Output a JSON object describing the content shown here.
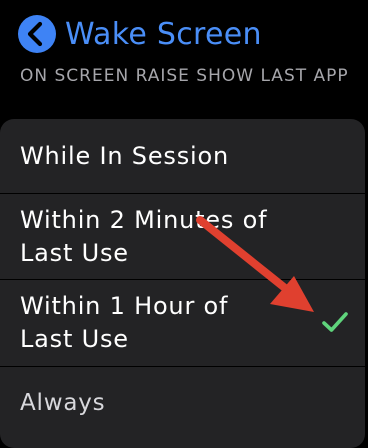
{
  "nav": {
    "back_icon": "chevron-left-icon",
    "title": "Wake Screen"
  },
  "section": {
    "header": "ON SCREEN RAISE SHOW LAST APP"
  },
  "options": [
    {
      "label": "While In Session",
      "selected": false
    },
    {
      "label": "Within 2 Minutes of Last Use",
      "selected": false
    },
    {
      "label": "Within 1 Hour of Last Use",
      "selected": true
    },
    {
      "label": "Always",
      "selected": false
    }
  ],
  "icons": {
    "checkmark": "checkmark-icon",
    "annotation": "red-arrow-icon"
  },
  "colors": {
    "background": "#000000",
    "accent": "#4a8ef7",
    "back_button": "#3e83f5",
    "cell": "#232325",
    "header_text": "#a6a6ab",
    "checkmark": "#5fd47c",
    "arrow": "#e0402f"
  }
}
